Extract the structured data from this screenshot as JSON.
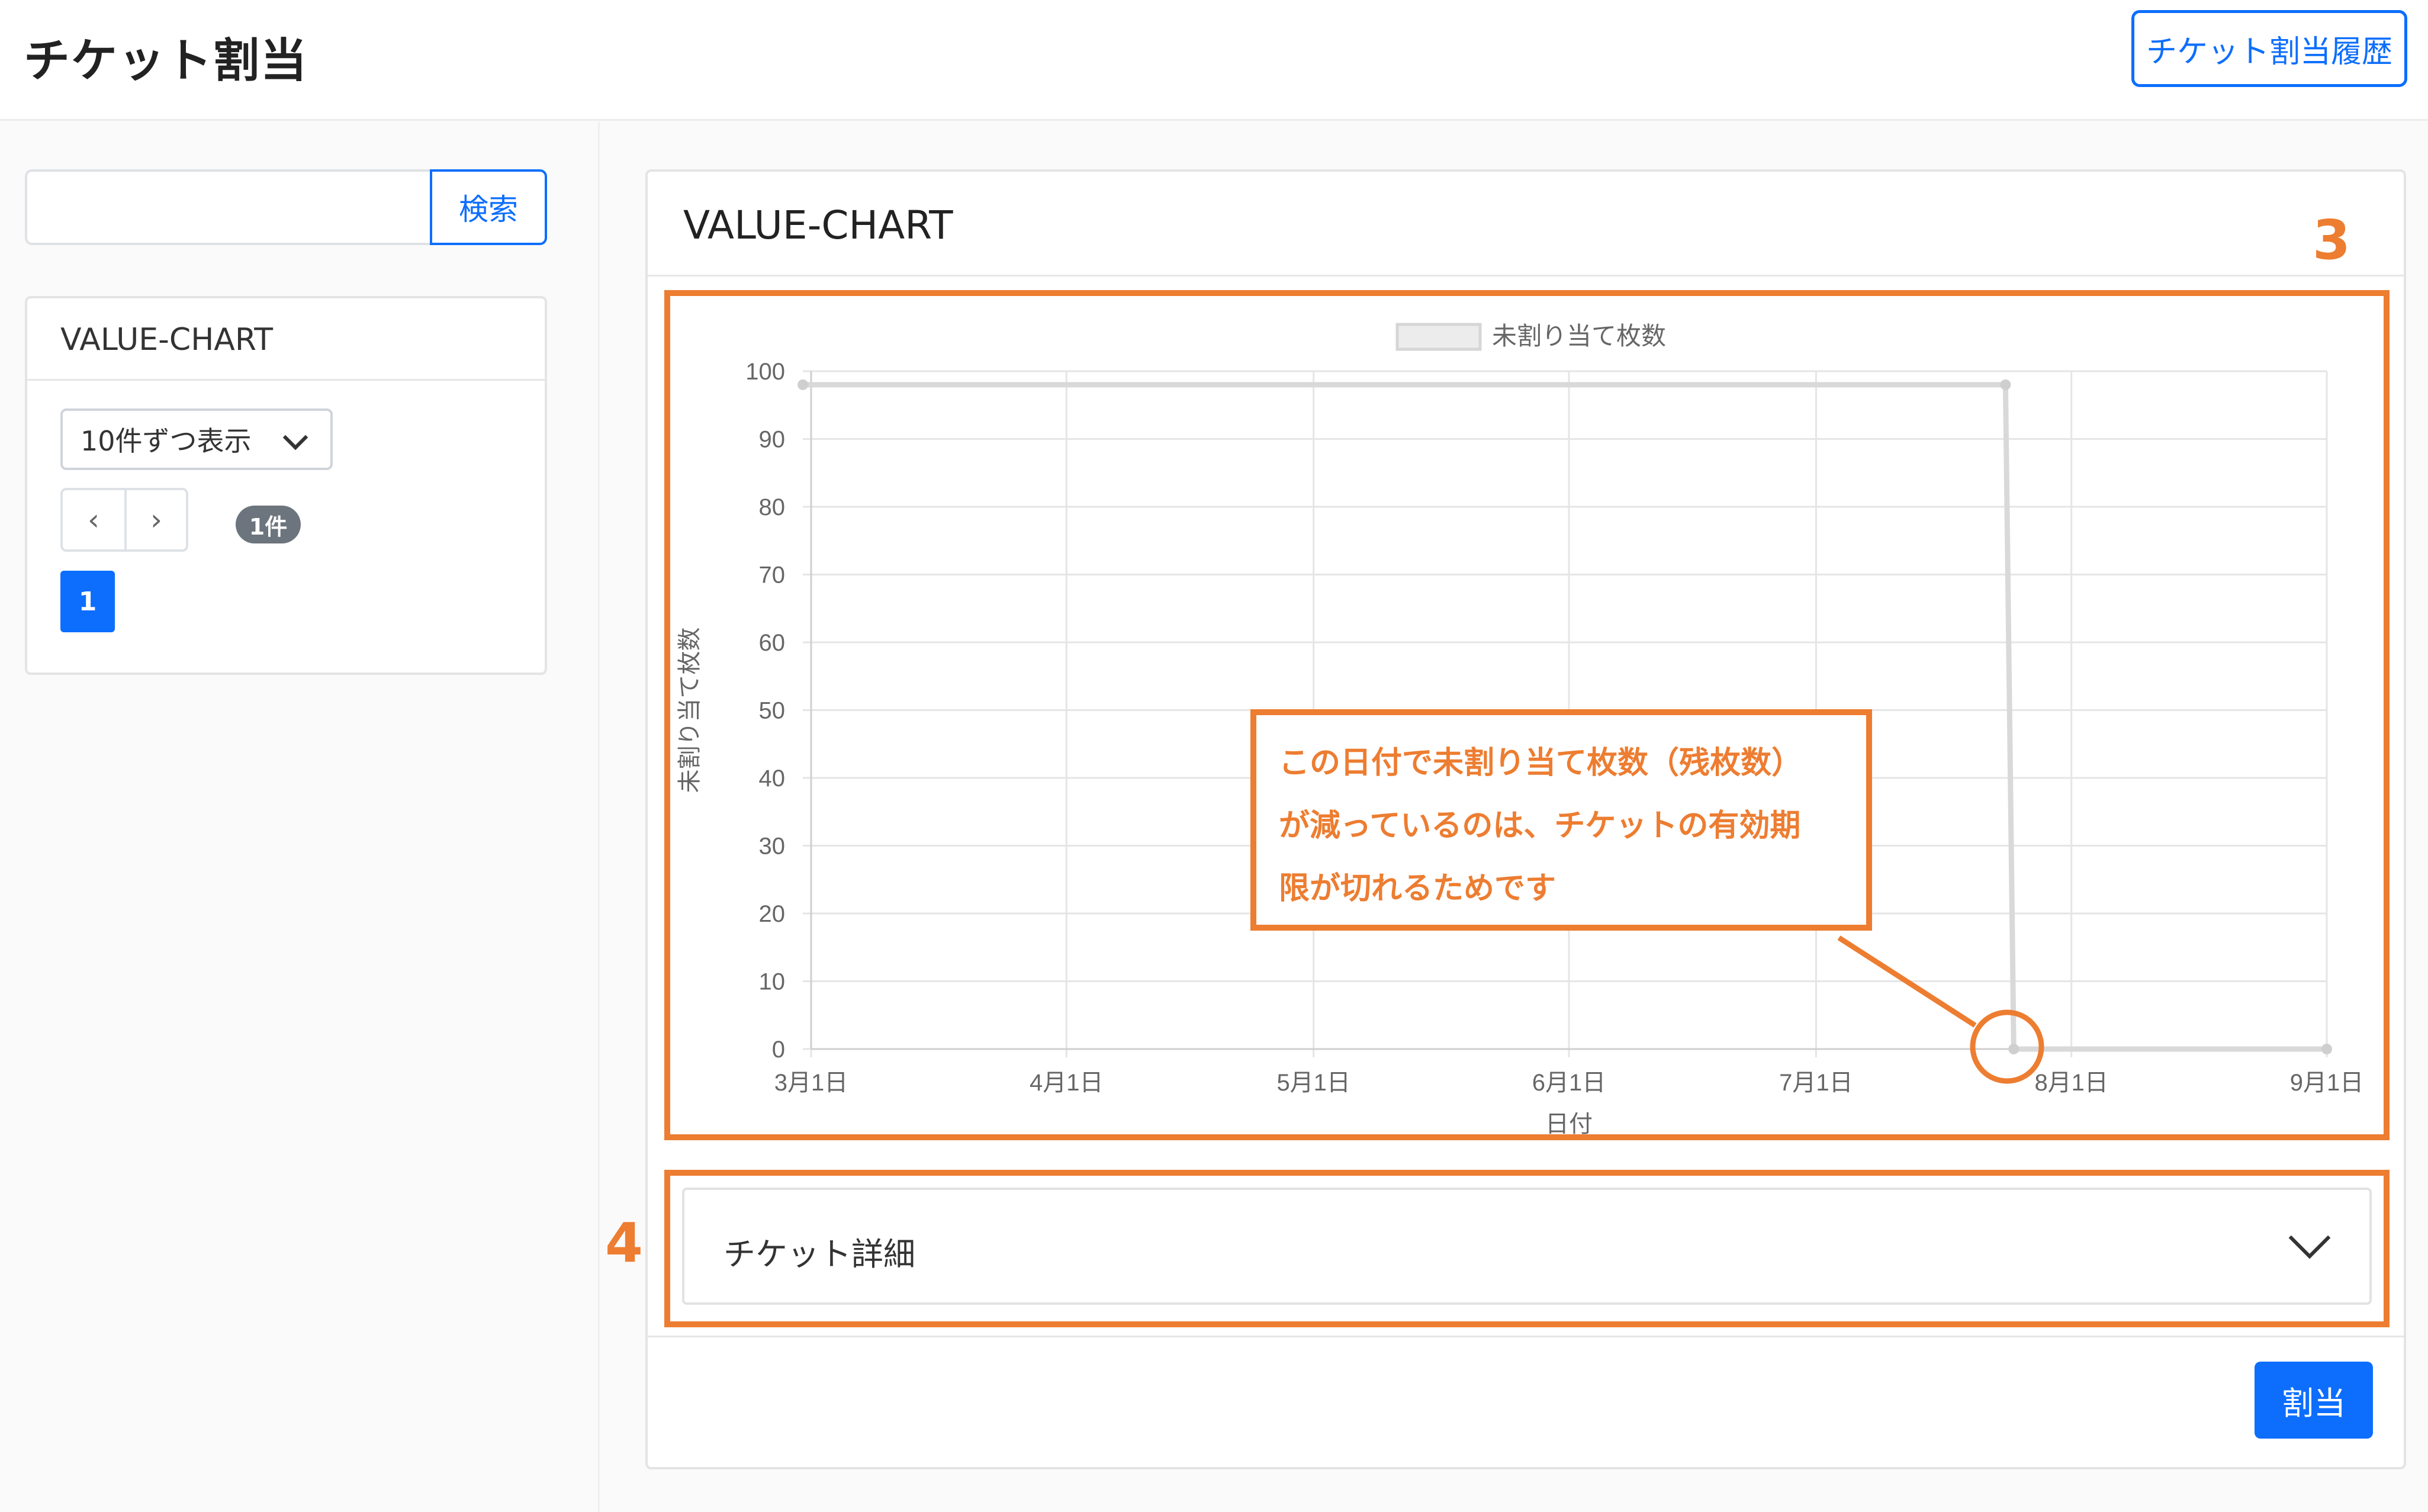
{
  "header": {
    "title": "チケット割当",
    "history_button": "チケット割当履歴"
  },
  "sidebar": {
    "search_button": "検索",
    "search_value": "",
    "card_title": "VALUE-CHART",
    "per_page": "10件ずつ表示",
    "prev_icon": "‹",
    "next_icon": "›",
    "count_badge": "1件",
    "current_page": "1"
  },
  "main": {
    "card_title": "VALUE-CHART",
    "accordion_label": "チケット詳細",
    "assign_button": "割当"
  },
  "markers": {
    "chart": "3",
    "accordion": "4"
  },
  "annotation": {
    "lines": [
      "この日付で未割り当て枚数（残枚数）",
      "が減っているのは、チケットの有効期",
      "限が切れるためです"
    ]
  },
  "colors": {
    "accent": "#0d6efd",
    "annotation": "#ed7d31",
    "series": "#d9d9d9"
  },
  "chart_data": {
    "type": "line",
    "title": "",
    "legend": "top",
    "xlabel": "日付",
    "ylabel": "未割り当て枚数",
    "x_ticks": [
      "3月1日",
      "4月1日",
      "5月1日",
      "6月1日",
      "7月1日",
      "8月1日",
      "9月1日"
    ],
    "y_ticks": [
      "0",
      "10",
      "20",
      "30",
      "40",
      "50",
      "60",
      "70",
      "80",
      "90",
      "100"
    ],
    "ylim": [
      0,
      100
    ],
    "xlim": [
      "2023-03-01",
      "2023-09-01"
    ],
    "series": [
      {
        "name": "未割り当て枚数",
        "points": [
          {
            "date": "2023-02-28",
            "value": 98
          },
          {
            "date": "2023-07-24",
            "value": 98
          },
          {
            "date": "2023-07-25",
            "value": 0
          },
          {
            "date": "2023-09-01",
            "value": 0
          }
        ]
      }
    ]
  }
}
